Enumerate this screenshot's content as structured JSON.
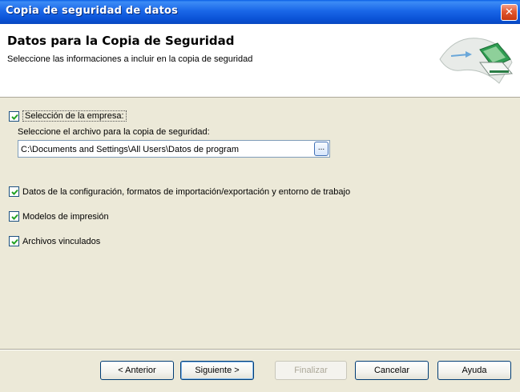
{
  "window": {
    "title": "Copia de seguridad de datos",
    "close_glyph": "✕"
  },
  "header": {
    "title": "Datos para la Copia de Seguridad",
    "subtitle": "Seleccione las informaciones a incluir en la copia de seguridad",
    "icon": "backup-drive-icon"
  },
  "options": {
    "empresa": {
      "label": "Selección de la empresa:",
      "checked": true
    },
    "file_prompt": "Seleccione el archivo para la copia de seguridad:",
    "path_value": "C:\\Documents and Settings\\All Users\\Datos de program",
    "browse_label": "...",
    "configuracion": {
      "label": "Datos de la configuración, formatos de importación/exportación y entorno de trabajo",
      "checked": true
    },
    "modelos": {
      "label": "Modelos de impresión",
      "checked": true
    },
    "archivos": {
      "label": "Archivos vinculados",
      "checked": true
    }
  },
  "buttons": {
    "anterior": "< Anterior",
    "siguiente": "Siguiente >",
    "finalizar": "Finalizar",
    "cancelar": "Cancelar",
    "ayuda": "Ayuda"
  },
  "colors": {
    "titlebar": "#0a52d6",
    "check_mark": "#21a121",
    "dialog_bg": "#ece9d8"
  }
}
